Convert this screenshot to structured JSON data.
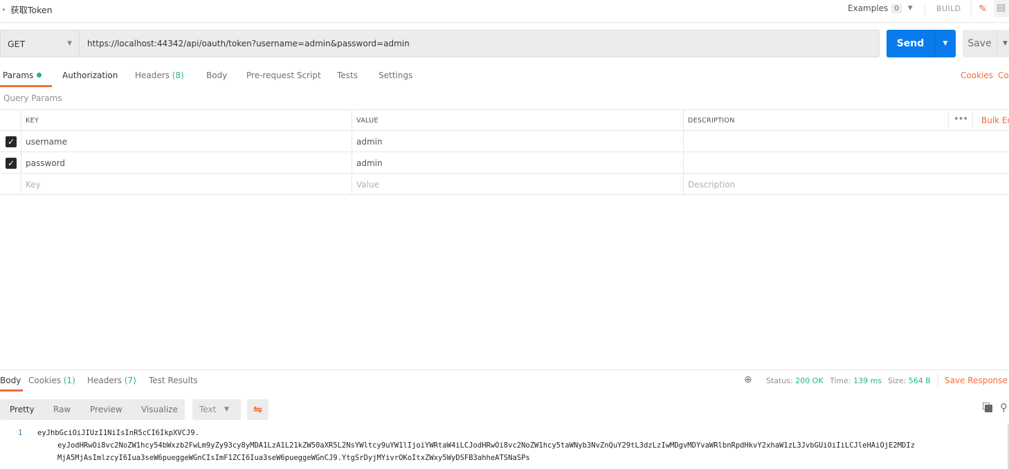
{
  "request": {
    "title": "获取Token",
    "examples_label": "Examples",
    "examples_count": "0",
    "build_label": "BUILD",
    "method": "GET",
    "url": "https://localhost:44342/api/oauth/token?username=admin&password=admin",
    "send_label": "Send",
    "save_label": "Save"
  },
  "request_tabs": [
    {
      "label": "Params",
      "count": "",
      "active": true
    },
    {
      "label": "Authorization",
      "count": ""
    },
    {
      "label": "Headers",
      "count": "(8)"
    },
    {
      "label": "Body",
      "count": ""
    },
    {
      "label": "Pre-request Script",
      "count": ""
    },
    {
      "label": "Tests",
      "count": ""
    },
    {
      "label": "Settings",
      "count": ""
    }
  ],
  "right_links": {
    "cookies": "Cookies",
    "code": "Co"
  },
  "query_params": {
    "label": "Query Params",
    "headers": {
      "key": "KEY",
      "value": "VALUE",
      "description": "DESCRIPTION"
    },
    "more_label": "•••",
    "bulk_edit": "Bulk Ed",
    "rows": [
      {
        "checked": true,
        "key": "username",
        "value": "admin",
        "description": ""
      },
      {
        "checked": true,
        "key": "password",
        "value": "admin",
        "description": ""
      }
    ],
    "placeholders": {
      "key": "Key",
      "value": "Value",
      "description": "Description"
    }
  },
  "response": {
    "tabs": [
      {
        "label": "Body",
        "count": "",
        "active": true
      },
      {
        "label": "Cookies",
        "count": "(1)"
      },
      {
        "label": "Headers",
        "count": "(7)"
      },
      {
        "label": "Test Results",
        "count": ""
      }
    ],
    "status_label": "Status:",
    "status_value": "200 OK",
    "time_label": "Time:",
    "time_value": "139 ms",
    "size_label": "Size:",
    "size_value": "564 B",
    "save_response": "Save Response",
    "view_modes": [
      "Pretty",
      "Raw",
      "Preview",
      "Visualize"
    ],
    "format": "Text",
    "body_lines": [
      {
        "num": "1",
        "text": "eyJhbGciOiJIUzI1NiIsInR5cCI6IkpXVCJ9."
      },
      {
        "num": "",
        "text": "eyJodHRwOi8vc2NoZW1hcy54bWxzb2FwLm9yZy93cy8yMDA1LzA1L21kZW50aXR5L2NsYWltcy9uYW1lIjoiYWRtaW4iLCJodHRwOi8vc2NoZW1hcy5taWNyb3NvZnQuY29tL3dzLzIwMDgvMDYvaWRlbnRpdHkvY2xhaW1zL3JvbGUiOiIiLCJleHAiOjE2MDIz"
      },
      {
        "num": "",
        "text": "MjA5MjAsImlzcyI6Iua3seW6pueggeWGnCIsImF1ZCI6Iua3seW6pueggeWGnCJ9.YtgSrDyjMYivrOKoItxZWxy5WyDSFB3ahheATSNaSPs"
      }
    ]
  },
  "icons": {
    "caret": "▸",
    "dropdown": "▼",
    "edit": "✎",
    "comment": "▤",
    "check": "✓",
    "globe": "⊕",
    "wrap": "⇋",
    "search": "⚲"
  }
}
